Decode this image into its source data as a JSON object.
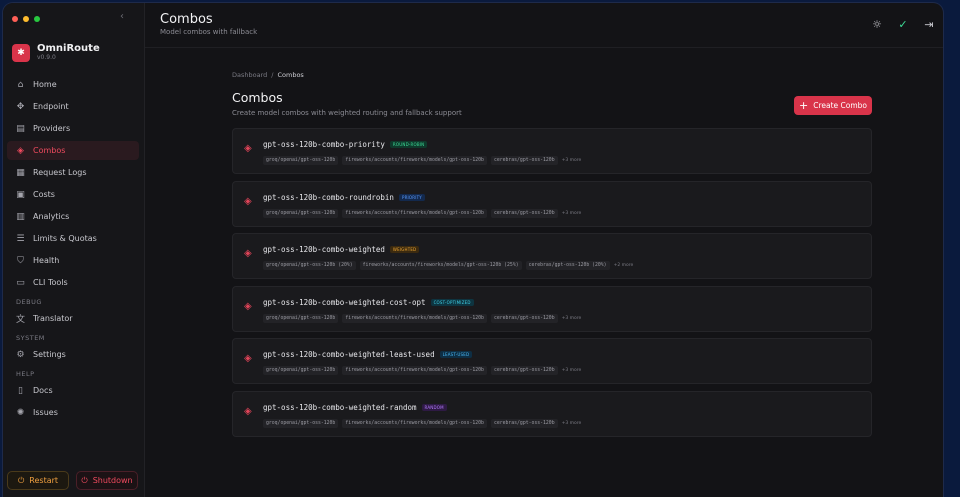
{
  "app": {
    "name": "OmniRoute",
    "version": "v0.9.0"
  },
  "traffic_colors": [
    "#ff5f57",
    "#febc2e",
    "#28c840"
  ],
  "nav": {
    "items": [
      {
        "label": "Home",
        "icon": "home-icon",
        "glyph": "⌂"
      },
      {
        "label": "Endpoint",
        "icon": "endpoint-icon",
        "glyph": "✥"
      },
      {
        "label": "Providers",
        "icon": "providers-icon",
        "glyph": "▤"
      },
      {
        "label": "Combos",
        "icon": "layers-icon",
        "glyph": "◈",
        "active": true
      },
      {
        "label": "Request Logs",
        "icon": "logs-icon",
        "glyph": "▦"
      },
      {
        "label": "Costs",
        "icon": "costs-icon",
        "glyph": "▣"
      },
      {
        "label": "Analytics",
        "icon": "analytics-icon",
        "glyph": "▥"
      },
      {
        "label": "Limits & Quotas",
        "icon": "sliders-icon",
        "glyph": "☰"
      },
      {
        "label": "Health",
        "icon": "shield-icon",
        "glyph": "⛉"
      },
      {
        "label": "CLI Tools",
        "icon": "terminal-icon",
        "glyph": "▭"
      }
    ],
    "debug_label": "DEBUG",
    "debug_items": [
      {
        "label": "Translator",
        "icon": "translate-icon",
        "glyph": "文"
      }
    ],
    "system_label": "SYSTEM",
    "system_items": [
      {
        "label": "Settings",
        "icon": "gear-icon",
        "glyph": "⚙"
      }
    ],
    "help_label": "HELP",
    "help_items": [
      {
        "label": "Docs",
        "icon": "book-icon",
        "glyph": "▯"
      },
      {
        "label": "Issues",
        "icon": "bug-icon",
        "glyph": "✺"
      }
    ]
  },
  "footer": {
    "restart_label": "Restart",
    "shutdown_label": "Shutdown"
  },
  "header": {
    "title": "Combos",
    "subtitle": "Model combos with fallback"
  },
  "breadcrumb": {
    "parent": "Dashboard",
    "separator": "/",
    "current": "Combos"
  },
  "page": {
    "title": "Combos",
    "subtitle": "Create model combos with weighted routing and fallback support",
    "create_label": "Create Combo"
  },
  "combos": [
    {
      "name": "gpt-oss-120b-combo-priority",
      "badge": "ROUND-ROBIN",
      "badge_class": "b-rr",
      "models": [
        "groq/openai/gpt-oss-120b",
        "fireworks/accounts/fireworks/models/gpt-oss-120b",
        "cerebras/gpt-oss-120b"
      ],
      "more": "+3 more"
    },
    {
      "name": "gpt-oss-120b-combo-roundrobin",
      "badge": "PRIORITY",
      "badge_class": "b-pr",
      "models": [
        "groq/openai/gpt-oss-120b",
        "fireworks/accounts/fireworks/models/gpt-oss-120b",
        "cerebras/gpt-oss-120b"
      ],
      "more": "+3 more"
    },
    {
      "name": "gpt-oss-120b-combo-weighted",
      "badge": "WEIGHTED",
      "badge_class": "b-wt",
      "models": [
        "groq/openai/gpt-oss-120b (20%)",
        "fireworks/accounts/fireworks/models/gpt-oss-120b (25%)",
        "cerebras/gpt-oss-120b (20%)"
      ],
      "more": "+2 more"
    },
    {
      "name": "gpt-oss-120b-combo-weighted-cost-opt",
      "badge": "COST-OPTIMIZED",
      "badge_class": "b-co",
      "models": [
        "groq/openai/gpt-oss-120b",
        "fireworks/accounts/fireworks/models/gpt-oss-120b",
        "cerebras/gpt-oss-120b"
      ],
      "more": "+3 more"
    },
    {
      "name": "gpt-oss-120b-combo-weighted-least-used",
      "badge": "LEAST-USED",
      "badge_class": "b-lu",
      "models": [
        "groq/openai/gpt-oss-120b",
        "fireworks/accounts/fireworks/models/gpt-oss-120b",
        "cerebras/gpt-oss-120b"
      ],
      "more": "+3 more"
    },
    {
      "name": "gpt-oss-120b-combo-weighted-random",
      "badge": "RANDOM",
      "badge_class": "b-rd",
      "models": [
        "groq/openai/gpt-oss-120b",
        "fireworks/accounts/fireworks/models/gpt-oss-120b",
        "cerebras/gpt-oss-120b"
      ],
      "more": "+3 more"
    }
  ],
  "colors": {
    "accent": "#d9344a",
    "background": "#131316",
    "sidebar": "#161619",
    "card": "#1a1a1d"
  }
}
